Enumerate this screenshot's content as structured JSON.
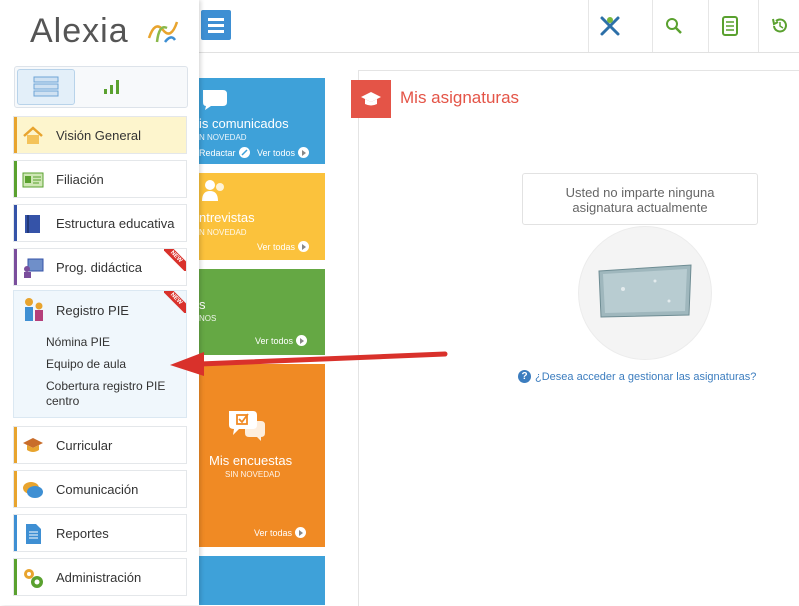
{
  "app": {
    "logo_text": "Alexia"
  },
  "colors": {
    "blue": "#3ea1d9",
    "yellow": "#fbc23c",
    "green": "#65a844",
    "orange": "#f08a24",
    "red": "#e45447",
    "link": "#3c7dbf"
  },
  "sidebar": {
    "items": [
      {
        "label": "Visión General",
        "icon": "home-icon"
      },
      {
        "label": "Filiación",
        "icon": "id-card-icon"
      },
      {
        "label": "Estructura educativa",
        "icon": "book-icon"
      },
      {
        "label": "Prog. didáctica",
        "icon": "presentation-icon",
        "badge": "NEW"
      },
      {
        "label": "Registro PIE",
        "icon": "people-icon",
        "badge": "NEW",
        "subitems": [
          "Nómina PIE",
          "Equipo de aula",
          "Cobertura registro PIE centro"
        ]
      },
      {
        "label": "Curricular",
        "icon": "graduation-cap-icon"
      },
      {
        "label": "Comunicación",
        "icon": "chat-icon"
      },
      {
        "label": "Reportes",
        "icon": "document-icon"
      },
      {
        "label": "Administración",
        "icon": "gears-icon"
      }
    ]
  },
  "tiles": {
    "comunicados": {
      "title": "is comunicados",
      "sub": "N NOVEDAD",
      "link1": "Redactar",
      "link2": "Ver todos"
    },
    "entrevistas": {
      "title": "ntrevistas",
      "sub": "N NOVEDAD",
      "link": "Ver todas"
    },
    "green": {
      "title": "s",
      "sub": "NOS",
      "link": "Ver todos"
    },
    "encuestas": {
      "title": "Mis encuestas",
      "sub": "SIN NOVEDAD",
      "link": "Ver todas"
    }
  },
  "main": {
    "title": "Mis asignaturas",
    "empty_line1": "Usted no imparte ninguna",
    "empty_line2": "asignatura actualmente",
    "help_link": "¿Desea acceder a gestionar las asignaturas?"
  }
}
